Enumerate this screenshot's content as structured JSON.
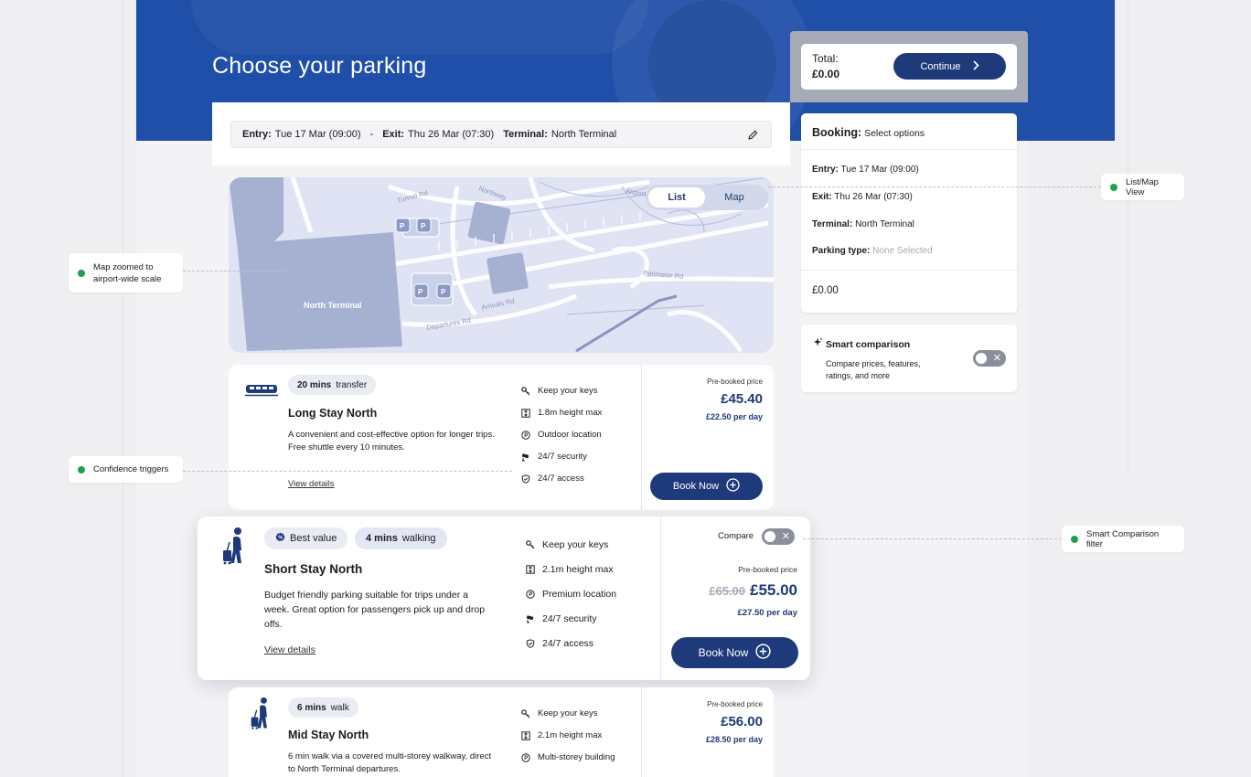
{
  "page": {
    "title": "Choose your parking"
  },
  "criteria": {
    "entry_label": "Entry:",
    "entry_value": "Tue 17 Mar (09:00)",
    "separator": "-",
    "exit_label": "Exit:",
    "exit_value": "Thu 26 Mar (07:30)",
    "terminal_label": "Terminal:",
    "terminal_value": "North Terminal",
    "edit_icon": "pencil-icon"
  },
  "map": {
    "toggle": {
      "list": "List",
      "map": "Map",
      "active": "List"
    },
    "terminal_label": "North Terminal",
    "roads": [
      "Tunnel Rd",
      "Northway",
      "Airport",
      "Perimeter Rd",
      "Arrivals Rd",
      "Departures Rd"
    ],
    "parking_marker": "P"
  },
  "summary": {
    "total_label": "Total:",
    "total_value": "£0.00",
    "continue_label": "Continue"
  },
  "booking": {
    "title": "Booking:",
    "subtitle": "Select options",
    "entry_label": "Entry:",
    "entry_value": "Tue 17 Mar (09:00)",
    "exit_label": "Exit:",
    "exit_value": "Thu 26 Mar (07:30)",
    "terminal_label": "Terminal:",
    "terminal_value": "North Terminal",
    "parking_type_label": "Parking type:",
    "parking_type_value": "None Selected",
    "amount": "£0.00"
  },
  "smart": {
    "title": "Smart comparison",
    "description": "Compare prices, features, ratings, and more",
    "toggle_on": false
  },
  "cards": [
    {
      "icon": "train-icon",
      "chip_bold": "20 mins",
      "chip_text": "transfer",
      "name": "Long Stay North",
      "description": "A convenient and cost-effective option for longer trips. Free shuttle every 10 minutes.",
      "details": "View details",
      "features": [
        "Keep your keys",
        "1.8m height max",
        "Outdoor location",
        "24/7 security",
        "24/7 access"
      ],
      "price_label": "Pre-booked price",
      "price": "£45.40",
      "per_day": "£22.50 per day",
      "book_label": "Book Now"
    },
    {
      "icon": "walking-luggage-icon",
      "badge": "Best value",
      "chip_bold": "4 mins",
      "chip_text": "walking",
      "name": "Short Stay North",
      "description": "Budget friendly parking suitable for trips under a week. Great option for passengers pick up and drop offs.",
      "details": "View details",
      "features": [
        "Keep your keys",
        "2.1m height max",
        "Premium location",
        "24/7 security",
        "24/7 access"
      ],
      "compare_label": "Compare",
      "price_label": "Pre-booked price",
      "old_price": "£65.00",
      "price": "£55.00",
      "per_day": "£27.50 per day",
      "book_label": "Book Now"
    },
    {
      "icon": "walking-luggage-icon",
      "chip_bold": "6 mins",
      "chip_text": "walk",
      "name": "Mid Stay North",
      "description": "6 min walk via a covered multi-storey walkway, direct to North Terminal departures.",
      "features": [
        "Keep your keys",
        "2.1m height max",
        "Multi-storey building"
      ],
      "price_label": "Pre-booked price",
      "price": "£56.00",
      "per_day": "£28.50 per day"
    }
  ],
  "annotations": {
    "map_note": "Map zoomed to airport-wide scale",
    "confidence_note": "Confidence triggers",
    "list_map_note": "List/Map View",
    "smart_note": "Smart Comparison filter"
  },
  "colors": {
    "brand": "#1e3a7b",
    "hero": "#1f4fa8",
    "note_dot": "#1fa04f"
  }
}
